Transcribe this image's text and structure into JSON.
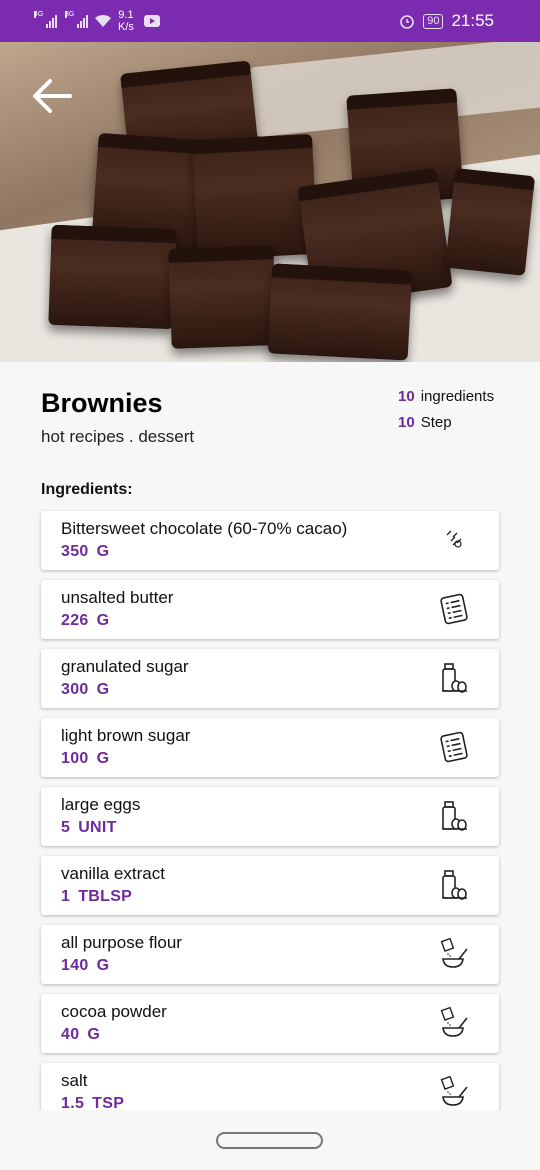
{
  "status_bar": {
    "net_type_1": "4G",
    "net_type_2": "3G",
    "speed_value": "9.1",
    "speed_unit": "K/s",
    "battery": "90",
    "time": "21:55"
  },
  "recipe": {
    "title": "Brownies",
    "subtitle": "hot recipes . dessert",
    "ingredients_count": "10",
    "ingredients_label": "ingredients",
    "steps_count": "10",
    "steps_label": "Step"
  },
  "section": {
    "ingredients_heading": "Ingredients:"
  },
  "ingredients": [
    {
      "name": "Bittersweet chocolate (60-70% cacao)",
      "amount": "350",
      "unit": "G",
      "icon": "chocolate-icon"
    },
    {
      "name": "unsalted butter",
      "amount": "226",
      "unit": "G",
      "icon": "list-icon"
    },
    {
      "name": "granulated sugar",
      "amount": "300",
      "unit": "G",
      "icon": "dairy-icon"
    },
    {
      "name": "light brown sugar",
      "amount": "100",
      "unit": "G",
      "icon": "list-icon"
    },
    {
      "name": "large eggs",
      "amount": "5",
      "unit": "UNIT",
      "icon": "dairy-icon"
    },
    {
      "name": "vanilla extract",
      "amount": "1",
      "unit": "TBLSP",
      "icon": "dairy-icon"
    },
    {
      "name": "all purpose flour",
      "amount": "140",
      "unit": "G",
      "icon": "mixing-bowl-icon"
    },
    {
      "name": "cocoa powder",
      "amount": "40",
      "unit": "G",
      "icon": "mixing-bowl-icon"
    },
    {
      "name": "salt",
      "amount": "1.5",
      "unit": "TSP",
      "icon": "mixing-bowl-icon"
    }
  ],
  "colors": {
    "accent": "#7b2bb0",
    "quantity": "#6f2a9c"
  }
}
